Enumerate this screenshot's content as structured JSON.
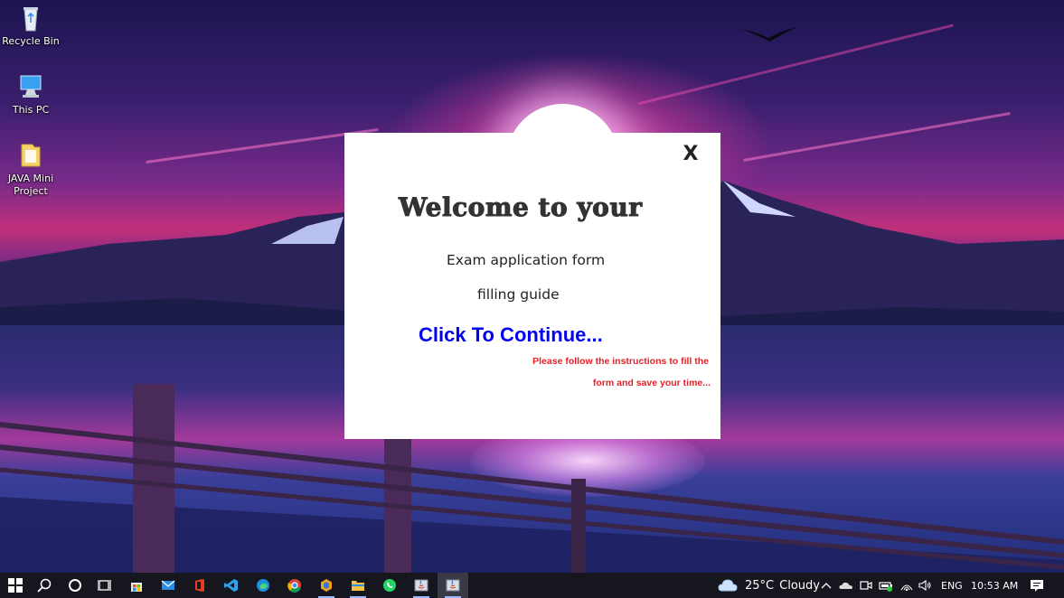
{
  "desktop": {
    "icons": [
      {
        "label": "Recycle Bin",
        "icon": "recycle-bin-icon"
      },
      {
        "label": "This PC",
        "icon": "this-pc-icon"
      },
      {
        "label": "JAVA Mini\nProject",
        "icon": "folder-icon"
      }
    ]
  },
  "dialog": {
    "close_label": "X",
    "title": "Welcome to your",
    "line1": "Exam application form",
    "line2": "filling guide",
    "continue_label": "Click To Continue...",
    "note_line1": "Please follow the instructions to fill the",
    "note_line2": "form and save your time..."
  },
  "taskbar": {
    "apps": [
      "start-icon",
      "search-icon",
      "cortana-icon",
      "task-view-icon",
      "store-icon",
      "mail-icon",
      "office-icon",
      "vscode-icon",
      "edge-icon",
      "chrome-icon",
      "app-icon",
      "file-explorer-icon",
      "whatsapp-icon",
      "java-icon",
      "java-app-active-icon"
    ],
    "weather_temp": "25°C",
    "weather_text": "Cloudy",
    "language": "ENG",
    "time": "10:53 AM"
  },
  "colors": {
    "continue": "#0000ee",
    "note": "#e8202a",
    "taskbar": "#16161e"
  }
}
